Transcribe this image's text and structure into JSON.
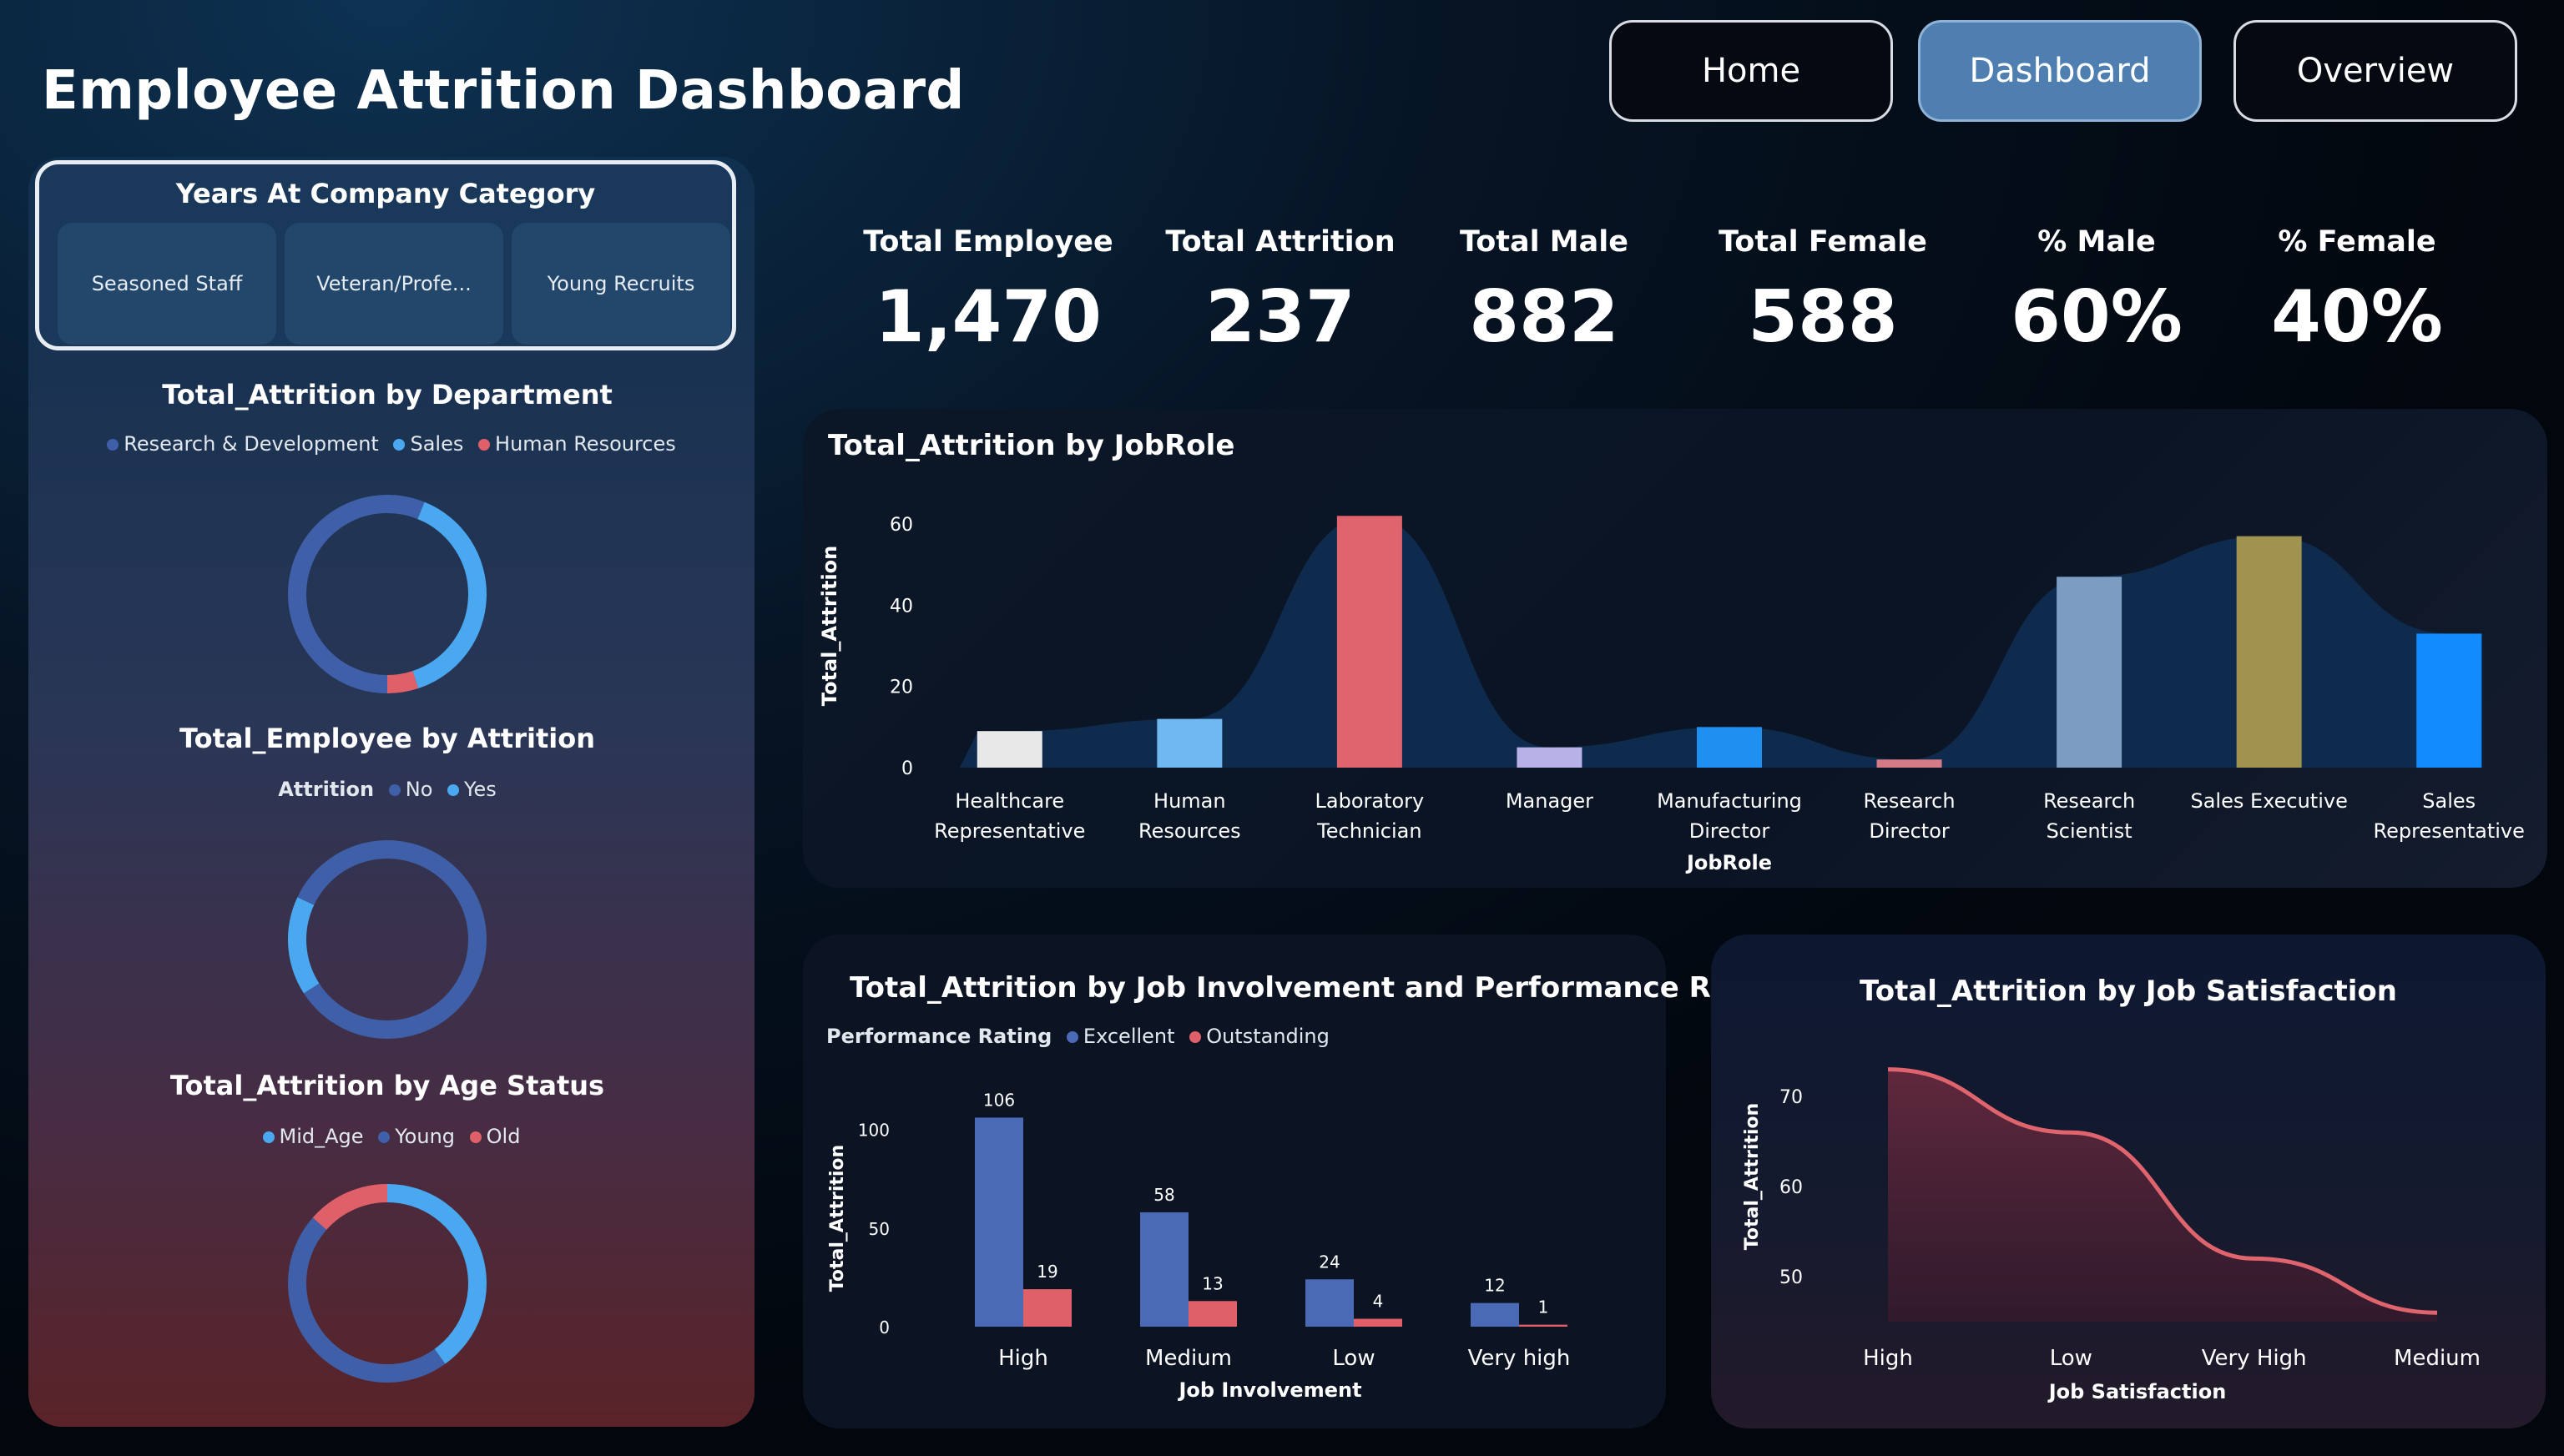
{
  "header": {
    "title": "Employee Attrition Dashboard",
    "nav": [
      {
        "label": "Home",
        "active": false
      },
      {
        "label": "Dashboard",
        "active": true
      },
      {
        "label": "Overview",
        "active": false
      }
    ]
  },
  "slicer": {
    "title": "Years At Company Category",
    "options": [
      "Seasoned Staff",
      "Veteran/Profe...",
      "Young Recruits"
    ]
  },
  "left_charts": {
    "department": {
      "title": "Total_Attrition by Department",
      "legend": [
        {
          "label": "Research & Development",
          "color": "#3f5fa8"
        },
        {
          "label": "Sales",
          "color": "#4aa8f0"
        },
        {
          "label": "Human Resources",
          "color": "#e0606a"
        }
      ],
      "values": [
        133,
        92,
        12
      ]
    },
    "employee_attrition": {
      "title": "Total_Employee by Attrition",
      "legend_title": "Attrition",
      "legend": [
        {
          "label": "No",
          "color": "#3f5fa8"
        },
        {
          "label": "Yes",
          "color": "#4aa8f0"
        }
      ],
      "values": [
        1233,
        237
      ]
    },
    "age_status": {
      "title": "Total_Attrition by Age Status",
      "legend": [
        {
          "label": "Mid_Age",
          "color": "#4aa8f0"
        },
        {
          "label": "Young",
          "color": "#3f5fa8"
        },
        {
          "label": "Old",
          "color": "#e0606a"
        }
      ],
      "values": [
        95,
        110,
        32
      ]
    }
  },
  "kpis": [
    {
      "label": "Total Employee",
      "value": "1,470"
    },
    {
      "label": "Total Attrition",
      "value": "237"
    },
    {
      "label": "Total Male",
      "value": "882"
    },
    {
      "label": "Total Female",
      "value": "588"
    },
    {
      "label": "% Male",
      "value": "60%"
    },
    {
      "label": "% Female",
      "value": "40%"
    }
  ],
  "chart_data": [
    {
      "type": "bar",
      "title": "Total_Attrition by JobRole",
      "xlabel": "JobRole",
      "ylabel": "Total_Attrition",
      "ylim": [
        0,
        60
      ],
      "yticks": [
        0,
        20,
        40,
        60
      ],
      "categories": [
        "Healthcare Representative",
        "Human Resources",
        "Laboratory Technician",
        "Manager",
        "Manufacturing Director",
        "Research Director",
        "Research Scientist",
        "Sales Executive",
        "Sales Representative"
      ],
      "category_lines": [
        [
          "Healthcare",
          "Representative"
        ],
        [
          "Human",
          "Resources"
        ],
        [
          "Laboratory",
          "Technician"
        ],
        [
          "Manager"
        ],
        [
          "Manufacturing",
          "Director"
        ],
        [
          "Research",
          "Director"
        ],
        [
          "Research",
          "Scientist"
        ],
        [
          "Sales Executive"
        ],
        [
          "Sales",
          "Representative"
        ]
      ],
      "values": [
        9,
        12,
        62,
        5,
        10,
        2,
        47,
        57,
        33
      ],
      "colors": [
        "#e8e8e8",
        "#6fb8f2",
        "#e0646e",
        "#b7b1e8",
        "#1f8ff0",
        "#d47a86",
        "#7c9cc2",
        "#a0924f",
        "#118bff"
      ]
    },
    {
      "type": "bar",
      "title": "Total_Attrition by Job Involvement and Performance Rating",
      "legend_title": "Performance Rating",
      "xlabel": "Job Involvement",
      "ylabel": "Total_Attrition",
      "ylim": [
        0,
        110
      ],
      "yticks": [
        0,
        50,
        100
      ],
      "categories": [
        "High",
        "Medium",
        "Low",
        "Very high"
      ],
      "series": [
        {
          "name": "Excellent",
          "color": "#4a6ab5",
          "values": [
            106,
            58,
            24,
            12
          ]
        },
        {
          "name": "Outstanding",
          "color": "#e0606a",
          "values": [
            19,
            13,
            4,
            1
          ]
        }
      ]
    },
    {
      "type": "area",
      "title": "Total_Attrition by Job Satisfaction",
      "xlabel": "Job Satisfaction",
      "ylabel": "Total_Attrition",
      "ylim": [
        45,
        75
      ],
      "yticks": [
        50,
        60,
        70
      ],
      "categories": [
        "High",
        "Low",
        "Very High",
        "Medium"
      ],
      "values": [
        73,
        66,
        52,
        46
      ],
      "color": "#e0646e"
    }
  ]
}
